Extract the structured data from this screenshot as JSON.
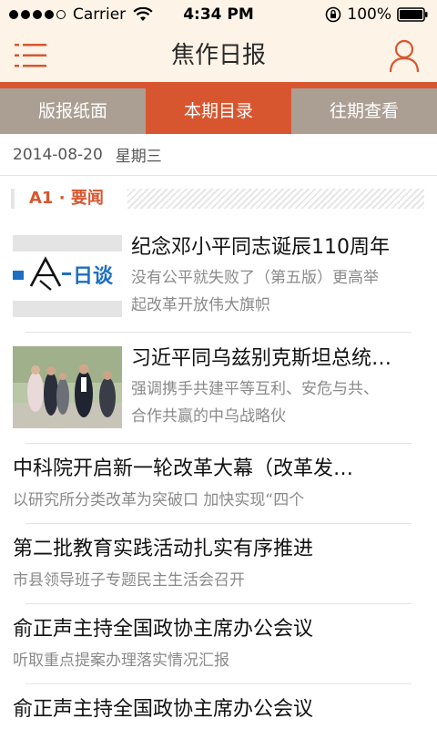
{
  "status_bar": {
    "carrier": "Carrier",
    "time": "4:34 PM",
    "battery": "100%"
  },
  "header": {
    "title": "焦作日报",
    "menu_icon": "hamburger-menu-icon",
    "profile_icon": "user-profile-icon"
  },
  "tabs": [
    {
      "label": "版报纸面",
      "active": false
    },
    {
      "label": "本期目录",
      "active": true
    },
    {
      "label": "往期查看",
      "active": false
    }
  ],
  "date_row": {
    "date": "2014-08-20",
    "weekday": "星期三"
  },
  "section": {
    "title": "A1 · 要闻"
  },
  "articles": [
    {
      "title": "纪念邓小平同志诞辰110周年",
      "subtitle_line1": "没有公平就失败了（第五版）更高举",
      "subtitle_line2": "起改革开放伟大旗帜",
      "thumb_text": "日谈"
    },
    {
      "title": "习近平同乌兹别克斯坦总统…",
      "subtitle_line1": "强调携手共建平等互利、安危与共、",
      "subtitle_line2": "合作共赢的中乌战略伙"
    },
    {
      "title": "中科院开启新一轮改革大幕（改革发…",
      "subtitle": "以研究所分类改革为突破口 加快实现“四个"
    },
    {
      "title": "第二批教育实践活动扎实有序推进",
      "subtitle": "市县领导班子专题民主生活会召开"
    },
    {
      "title": "俞正声主持全国政协主席办公会议",
      "subtitle": "听取重点提案办理落实情况汇报"
    },
    {
      "title": "俞正声主持全国政协主席办公会议",
      "subtitle": ""
    }
  ],
  "colors": {
    "accent": "#d8562f",
    "tab_bg": "#ab9f93",
    "header_bg": "#fdf3e6"
  }
}
